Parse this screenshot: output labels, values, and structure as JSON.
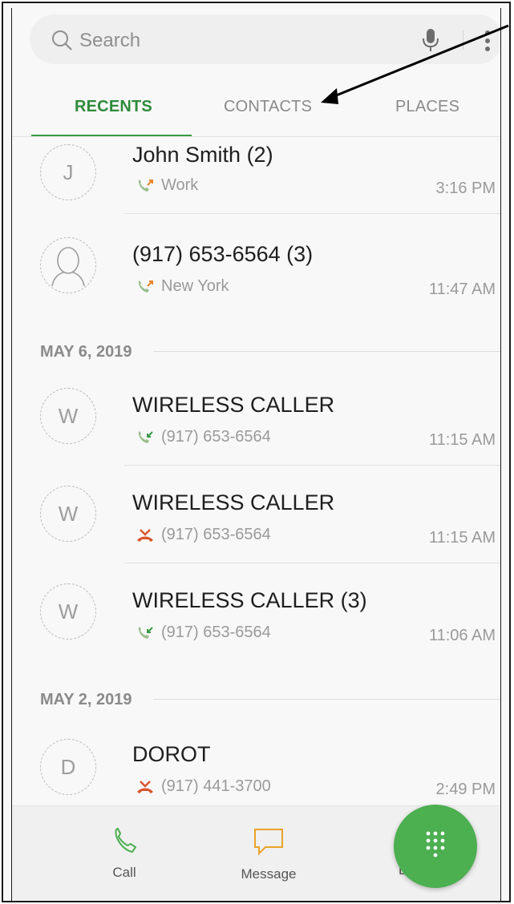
{
  "search": {
    "placeholder": "Search",
    "icons": [
      "search-icon",
      "microphone-icon",
      "more-vert-icon"
    ]
  },
  "tabs": [
    {
      "label": "RECENTS",
      "active": true
    },
    {
      "label": "CONTACTS",
      "active": false
    },
    {
      "label": "PLACES",
      "active": false
    }
  ],
  "calls": [
    {
      "initial": "J",
      "name": "John Smith (2)",
      "type": "outgoing",
      "detail": "Work",
      "time": "3:16 PM"
    },
    {
      "initial": "",
      "name": "(917) 653-6564 (3)",
      "type": "outgoing",
      "detail": "New York",
      "time": "11:47 AM"
    }
  ],
  "groups": [
    {
      "date": "MAY 6, 2019",
      "calls": [
        {
          "initial": "W",
          "name": "WIRELESS CALLER",
          "type": "incoming",
          "detail": "(917) 653-6564",
          "time": "11:15 AM"
        },
        {
          "initial": "W",
          "name": "WIRELESS CALLER",
          "type": "missed",
          "detail": "(917) 653-6564",
          "time": "11:15 AM"
        },
        {
          "initial": "W",
          "name": "WIRELESS CALLER (3)",
          "type": "incoming",
          "detail": "(917) 653-6564",
          "time": "11:06 AM"
        }
      ]
    },
    {
      "date": "MAY 2, 2019",
      "calls": [
        {
          "initial": "D",
          "name": "DOROT",
          "type": "missed",
          "detail": "(917) 441-3700",
          "time": "2:49 PM"
        }
      ]
    }
  ],
  "bottom_bar": {
    "call_label": "Call",
    "message_label": "Message",
    "details_label": "Details"
  },
  "colors": {
    "accent": "#2e8b3a",
    "fab": "#4caf50",
    "missed": "#d9542b",
    "outgoing_arrow": "#e8832a"
  }
}
